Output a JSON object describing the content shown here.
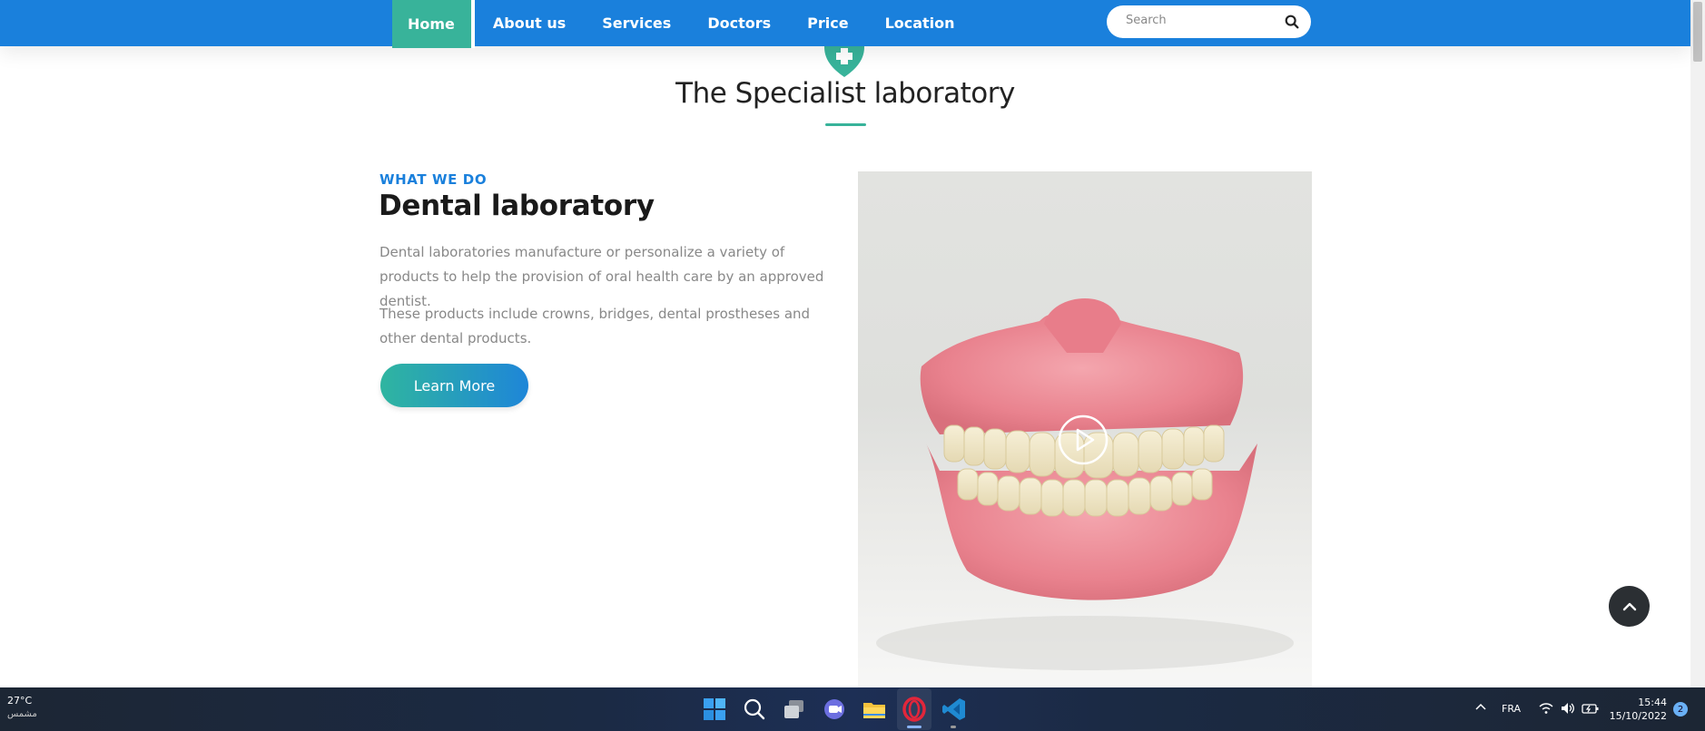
{
  "nav": {
    "items": [
      {
        "label": "Home",
        "active": true
      },
      {
        "label": "About us"
      },
      {
        "label": "Services"
      },
      {
        "label": "Doctors"
      },
      {
        "label": "Price"
      },
      {
        "label": "Location"
      }
    ],
    "search_placeholder": "Search"
  },
  "section": {
    "title": "The Specialist laboratory"
  },
  "content": {
    "eyebrow": "WHAT WE DO",
    "heading": "Dental laboratory",
    "para1": "Dental laboratories manufacture or personalize a variety of products to help the provision of oral health care by an approved dentist.",
    "para2": "These products include crowns, bridges, dental prostheses and other dental products.",
    "button": "Learn More"
  },
  "taskbar": {
    "weather_temp": "27°C",
    "weather_cond": "مشمس",
    "language": "FRA",
    "time": "15:44",
    "date": "15/10/2022",
    "notifications": "2"
  },
  "colors": {
    "primary": "#1a80dc",
    "accent": "#38b39a",
    "dark": "#2b2f33"
  }
}
